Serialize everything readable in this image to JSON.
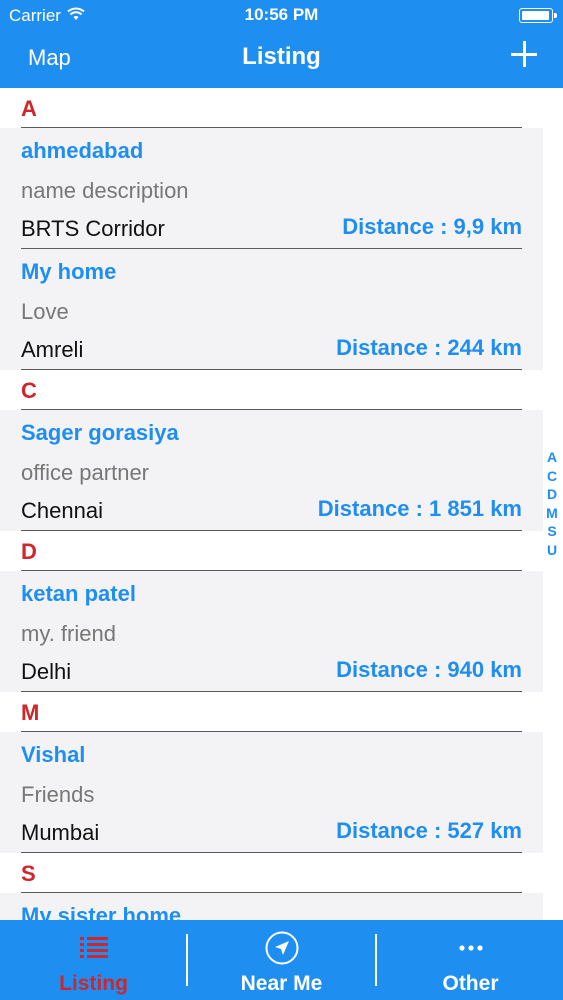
{
  "status_bar": {
    "carrier": "Carrier",
    "time": "10:56 PM",
    "battery_level": 0.95
  },
  "nav": {
    "left_label": "Map",
    "title": "Listing",
    "add_icon": "plus-icon"
  },
  "sections": [
    {
      "letter": "A",
      "items": [
        {
          "name": "ahmedabad",
          "description": "name description",
          "city": "BRTS Corridor",
          "distance": "Distance : 9,9 km"
        },
        {
          "name": "My home",
          "description": "Love",
          "city": "Amreli",
          "distance": "Distance : 244 km"
        }
      ]
    },
    {
      "letter": "C",
      "items": [
        {
          "name": "Sager gorasiya",
          "description": "office partner",
          "city": "Chennai",
          "distance": "Distance : 1 851 km"
        }
      ]
    },
    {
      "letter": "D",
      "items": [
        {
          "name": "ketan patel",
          "description": "my. friend",
          "city": "Delhi",
          "distance": "Distance : 940 km"
        }
      ]
    },
    {
      "letter": "M",
      "items": [
        {
          "name": "Vishal",
          "description": "Friends",
          "city": "Mumbai",
          "distance": "Distance : 527 km"
        }
      ]
    },
    {
      "letter": "S",
      "items": [
        {
          "name": "My sister home",
          "description": "",
          "city": "",
          "distance": ""
        }
      ]
    }
  ],
  "index": [
    "A",
    "C",
    "D",
    "M",
    "S",
    "U"
  ],
  "tabs": [
    {
      "label": "Listing",
      "icon": "list-icon",
      "active": true
    },
    {
      "label": "Near Me",
      "icon": "location-arrow-icon",
      "active": false
    },
    {
      "label": "Other",
      "icon": "more-dots-icon",
      "active": false
    }
  ],
  "colors": {
    "primary": "#1f8ef1",
    "accent": "#d0252a",
    "row_bg": "#f3f3f5"
  }
}
